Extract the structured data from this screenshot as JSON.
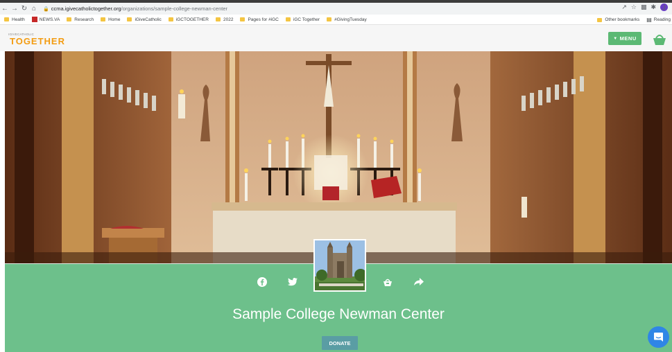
{
  "browser": {
    "url_domain": "ccma.igivecatholictogether.org",
    "url_path": "/organizations/sample-college-newman-center",
    "avatar_letter": "J",
    "bookmarks": [
      {
        "label": "Health",
        "icon": "folder"
      },
      {
        "label": "NEWS.VA",
        "icon": "news-icon"
      },
      {
        "label": "Research",
        "icon": "folder"
      },
      {
        "label": "Home",
        "icon": "folder"
      },
      {
        "label": "iGiveCatholic",
        "icon": "folder"
      },
      {
        "label": "iGCTOGETHER",
        "icon": "folder"
      },
      {
        "label": "2022",
        "icon": "folder"
      },
      {
        "label": "Pages for #iGC",
        "icon": "folder"
      },
      {
        "label": "iGC Together",
        "icon": "folder"
      },
      {
        "label": "#GivingTuesday",
        "icon": "folder"
      }
    ],
    "other_bookmarks": "Other bookmarks",
    "reading_list": "Reading"
  },
  "header": {
    "logo_top": "IGIVECATHOLIC",
    "logo_main": "TOGETHER",
    "menu_label": "MENU",
    "accent": "#5cb974",
    "logo_color": "#f39c12"
  },
  "organization": {
    "name": "Sample College Newman Center",
    "donate_label": "DONATE",
    "band_color": "#6dc08b"
  },
  "social_icons": [
    "facebook-icon",
    "twitter-icon",
    "basket-icon",
    "share-icon"
  ]
}
